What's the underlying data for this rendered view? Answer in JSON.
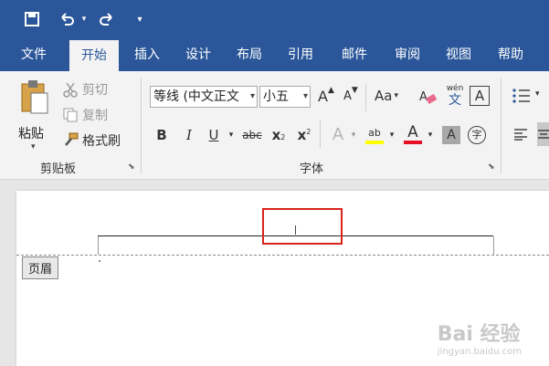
{
  "quick_access": {
    "icons": [
      "save-icon",
      "undo-icon",
      "dropdown-icon",
      "redo-icon",
      "customize-icon"
    ]
  },
  "tabs": [
    {
      "label": "文件"
    },
    {
      "label": "开始",
      "active": true
    },
    {
      "label": "插入"
    },
    {
      "label": "设计"
    },
    {
      "label": "布局"
    },
    {
      "label": "引用"
    },
    {
      "label": "邮件"
    },
    {
      "label": "审阅"
    },
    {
      "label": "视图"
    },
    {
      "label": "帮助"
    }
  ],
  "clipboard": {
    "paste_label": "粘贴",
    "cut_label": "剪切",
    "copy_label": "复制",
    "format_painter_label": "格式刷",
    "group_label": "剪贴板"
  },
  "font": {
    "font_name": "等线 (中文正文",
    "font_size": "小五",
    "group_label": "字体",
    "grow_label": "A",
    "shrink_label": "A",
    "case_label": "Aa",
    "phonetic_top": "wén",
    "phonetic_bottom": "文",
    "border_label": "A",
    "bold": "B",
    "italic": "I",
    "underline": "U",
    "strike": "abc",
    "subscript": "x",
    "superscript": "x",
    "effects": "A",
    "highlight": "ab",
    "color": "A",
    "shading": "A",
    "enclose": "字"
  },
  "document": {
    "header_label": "页眉"
  },
  "watermark": {
    "text": "Bai 经验",
    "sub": "jingyan.baidu.com"
  },
  "colors": {
    "brand": "#2b579a",
    "highlight": "#ffff00",
    "font_color": "#e81123",
    "annotation": "#d9231d"
  }
}
